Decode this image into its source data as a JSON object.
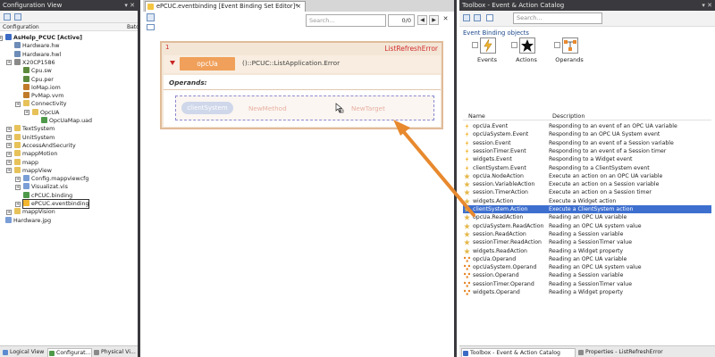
{
  "left_panel": {
    "title": "Configuration View",
    "col_configuration": "Configuration",
    "col_batch": "Batc",
    "tree": [
      {
        "label": "AsHelp_PCUC [Active]",
        "color": "#3b6bc5",
        "bold": true
      },
      {
        "label": "Hardware.hw",
        "color": "#6d8cb8"
      },
      {
        "label": "Hardware.hwl",
        "color": "#6d8cb8"
      },
      {
        "label": "X20CP1586",
        "color": "#8a8a8a"
      },
      {
        "label": "Cpu.sw",
        "color": "#5d8a3d"
      },
      {
        "label": "Cpu.per",
        "color": "#5d8a3d"
      },
      {
        "label": "IoMap.iom",
        "color": "#c07a2a"
      },
      {
        "label": "PvMap.vvm",
        "color": "#c07a2a"
      },
      {
        "label": "Connectivity",
        "color": "#e7c25a"
      },
      {
        "label": "OpcUA",
        "color": "#e7c25a"
      },
      {
        "label": "OpcUaMap.uad",
        "color": "#4f9a4a"
      },
      {
        "label": "TextSystem",
        "color": "#e7c25a"
      },
      {
        "label": "UnitSystem",
        "color": "#e7c25a"
      },
      {
        "label": "AccessAndSecurity",
        "color": "#e7c25a"
      },
      {
        "label": "mappMotion",
        "color": "#e7c25a"
      },
      {
        "label": "mapp",
        "color": "#e7c25a"
      },
      {
        "label": "mappView",
        "color": "#e7c25a"
      },
      {
        "label": "Config.mappviewcfg",
        "color": "#7a9ed6"
      },
      {
        "label": "Visualizat.vis",
        "color": "#7a9ed6"
      },
      {
        "label": "cPCUC.binding",
        "color": "#4f9a4a"
      },
      {
        "label": "ePCUC.eventbinding",
        "color": "#f2b630"
      },
      {
        "label": "mappVision",
        "color": "#e7c25a"
      },
      {
        "label": "Hardware.jpg",
        "color": "#7a9ed6"
      }
    ],
    "tabs": [
      "Logical View",
      "Configurat...",
      "Physical Vi..."
    ]
  },
  "center_panel": {
    "doc_tab_title": "ePCUC.eventbinding [Event Binding Set Editor]*",
    "search_placeholder": "Search...",
    "search_count": "0/0",
    "binding": {
      "number": "1",
      "title": "ListRefreshError",
      "event_source": "opcUa",
      "event_text": "()::PCUC::ListApplication.Error",
      "operands_label": "Operands:",
      "ghost_source": "clientSystem",
      "ghost_method": "NewMethod",
      "ghost_target": "NewTarget"
    }
  },
  "right_panel": {
    "title": "Toolbox - Event & Action Catalog",
    "search_placeholder": "Search...",
    "section_title": "Event Binding objects",
    "categories": [
      "Events",
      "Actions",
      "Operands"
    ],
    "col_name": "Name",
    "col_description": "Description",
    "items": [
      {
        "name": "opcUa.Event",
        "desc": "Responding to an event of an OPC UA variable",
        "icon": "lightning-icon"
      },
      {
        "name": "opcUaSystem.Event",
        "desc": "Responding to an OPC UA System event",
        "icon": "lightning-icon"
      },
      {
        "name": "session.Event",
        "desc": "Responding to an event of a Session variable",
        "icon": "lightning-icon"
      },
      {
        "name": "sessionTimer.Event",
        "desc": "Responding to an event of a Session timer",
        "icon": "lightning-icon"
      },
      {
        "name": "widgets.Event",
        "desc": "Responding to a Widget event",
        "icon": "lightning-icon"
      },
      {
        "name": "clientSystem.Event",
        "desc": "Responding to a ClientSystem event",
        "icon": "lightning-icon"
      },
      {
        "name": "opcUa.NodeAction",
        "desc": "Execute an action on an OPC UA variable",
        "icon": "star-icon"
      },
      {
        "name": "session.VariableAction",
        "desc": "Execute an action on a Session variable",
        "icon": "star-icon"
      },
      {
        "name": "session.TimerAction",
        "desc": "Execute an action on a Session timer",
        "icon": "star-icon"
      },
      {
        "name": "widgets.Action",
        "desc": "Execute a Widget action",
        "icon": "star-icon"
      },
      {
        "name": "clientSystem.Action",
        "desc": "Execute a ClientSystem action",
        "icon": "star-icon",
        "selected": true
      },
      {
        "name": "opcUa.ReadAction",
        "desc": "Reading an OPC UA variable",
        "icon": "star-icon"
      },
      {
        "name": "opcUaSystem.ReadAction",
        "desc": "Reading an OPC UA system value",
        "icon": "star-icon"
      },
      {
        "name": "session.ReadAction",
        "desc": "Reading a Session variable",
        "icon": "star-icon"
      },
      {
        "name": "sessionTimer.ReadAction",
        "desc": "Reading a SessionTimer value",
        "icon": "star-icon"
      },
      {
        "name": "widgets.ReadAction",
        "desc": "Reading a Widget property",
        "icon": "star-icon"
      },
      {
        "name": "opcUa.Operand",
        "desc": "Reading an OPC UA variable",
        "icon": "operand-icon"
      },
      {
        "name": "opcUaSystem.Operand",
        "desc": "Reading an OPC UA system value",
        "icon": "operand-icon"
      },
      {
        "name": "session.Operand",
        "desc": "Reading a Session variable",
        "icon": "operand-icon"
      },
      {
        "name": "sessionTimer.Operand",
        "desc": "Reading a SessionTimer value",
        "icon": "operand-icon"
      },
      {
        "name": "widgets.Operand",
        "desc": "Reading a Widget property",
        "icon": "operand-icon"
      }
    ],
    "tabs": [
      "Toolbox - Event & Action Catalog",
      "Properties - ListRefreshError"
    ]
  },
  "colors": {
    "accent_orange": "#f0a05a",
    "error_red": "#d22f2f",
    "selection_blue": "#3d6fcf",
    "arrow_orange": "#e8892e"
  }
}
